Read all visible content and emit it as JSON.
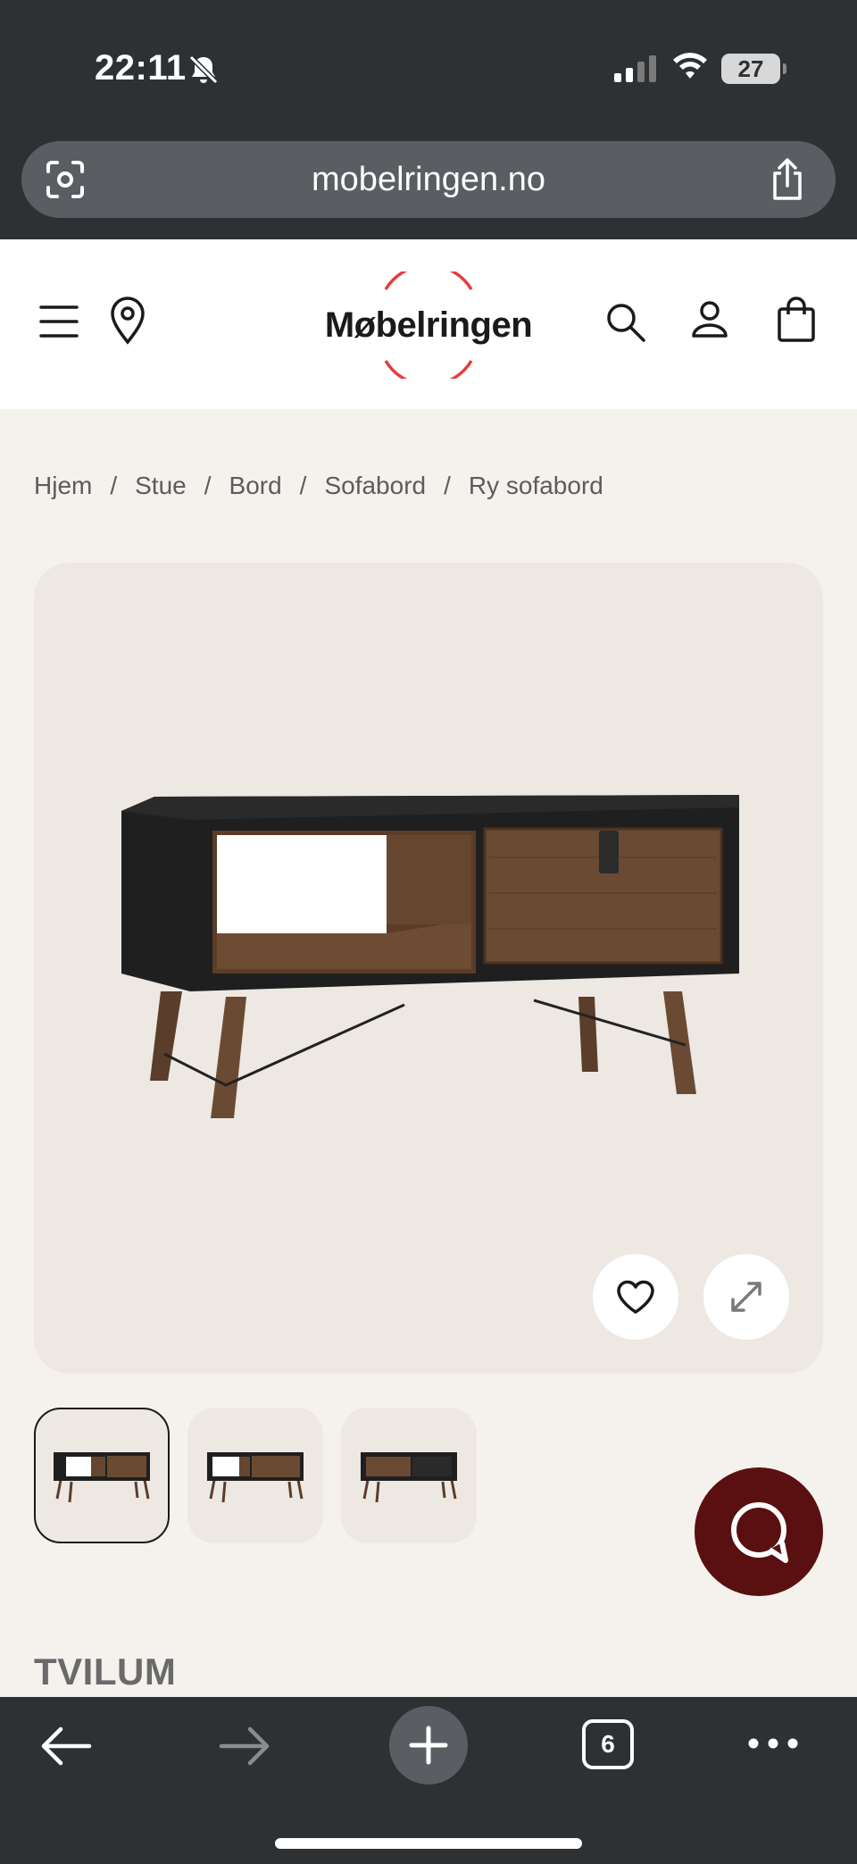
{
  "status_bar": {
    "time": "22:11",
    "battery": "27"
  },
  "browser": {
    "url": "mobelringen.no",
    "tab_count": "6"
  },
  "site": {
    "logo_text": "Møbelringen",
    "brand_color": "#e63c3c"
  },
  "breadcrumb": {
    "items": [
      "Hjem",
      "Stue",
      "Bord",
      "Sofabord",
      "Ry sofabord"
    ],
    "separator": "/"
  },
  "gallery": {
    "thumbnail_count": 3,
    "selected_thumbnail": 0
  },
  "product": {
    "brand": "TVILUM"
  },
  "icons": [
    "camera-lens-icon",
    "share-icon",
    "menu-icon",
    "location-pin-icon",
    "search-icon",
    "user-icon",
    "shopping-bag-icon",
    "heart-icon",
    "expand-icon",
    "chat-icon",
    "back-arrow-icon",
    "forward-arrow-icon",
    "plus-icon",
    "more-icon"
  ]
}
